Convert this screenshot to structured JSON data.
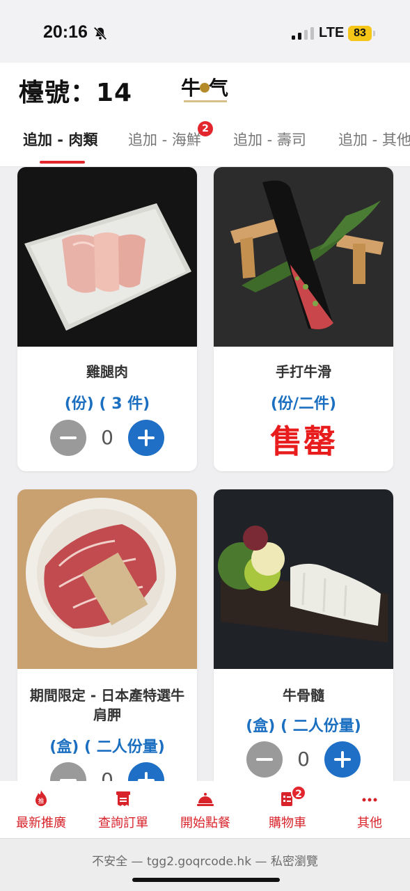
{
  "status_bar": {
    "time": "20:16",
    "network": "LTE",
    "battery": "83",
    "icons": [
      "bell-slash-icon",
      "signal-icon"
    ]
  },
  "header": {
    "table_label": "檯號：14",
    "logo_icon": "gyu-kaku-logo",
    "tabs": [
      {
        "label": "追加 - 肉類",
        "active": true
      },
      {
        "label": "追加 - 海鮮",
        "badge": "2"
      },
      {
        "label": "追加 - 壽司"
      },
      {
        "label": "追加 - 其他"
      }
    ]
  },
  "products": [
    {
      "name": "雞腿肉",
      "unit": "(份) ( 3 件)",
      "quantity": "0",
      "photo": "chicken-thigh-photo"
    },
    {
      "name": "手打牛滑",
      "unit": "(份/二件)",
      "status": "售罄",
      "photo": "beef-paste-photo"
    },
    {
      "name": "期間限定 - 日本產特選牛肩胛",
      "unit": "(盒) ( 二人份量)",
      "quantity": "0",
      "photo": "wagyu-chuck-photo"
    },
    {
      "name": "牛骨髓",
      "unit": "(盒) ( 二人份量)",
      "quantity": "0",
      "photo": "bone-marrow-photo"
    }
  ],
  "bottom_nav": [
    {
      "label": "最新推廣",
      "icon": "flame-icon"
    },
    {
      "label": "查詢訂單",
      "icon": "receipt-icon"
    },
    {
      "label": "開始點餐",
      "icon": "cloche-icon"
    },
    {
      "label": "購物車",
      "icon": "cart-icon",
      "badge": "2"
    },
    {
      "label": "其他",
      "icon": "more-dots-icon"
    }
  ],
  "browser": {
    "url_text": "不安全 — tgg2.goqrcode.hk — 私密瀏覽"
  },
  "colors": {
    "accent_red": "#e3262e",
    "accent_blue": "#1e6fc5",
    "sold_out_red": "#e81c1c"
  }
}
